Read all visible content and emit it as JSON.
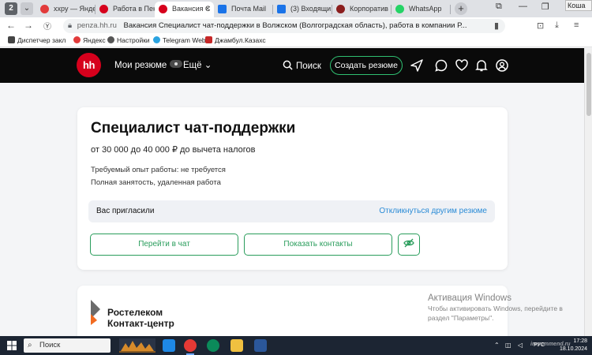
{
  "browser": {
    "tabs": [
      {
        "title": "хxpy — Яндекс",
        "color": "#e23b3b"
      },
      {
        "title": "Работа в Пен",
        "color": "#d6001c"
      },
      {
        "title": "Вакансия С",
        "color": "#d6001c",
        "active": true
      },
      {
        "title": "Почта Mail",
        "color": "#1a73e8"
      },
      {
        "title": "(3) Входящи",
        "color": "#1a73e8"
      },
      {
        "title": "Корпоратив",
        "color": "#8b1e1e"
      },
      {
        "title": "WhatsApp",
        "color": "#25d366"
      }
    ],
    "close_label": "×",
    "new_tab_label": "+",
    "corner_label": "Коша",
    "url_host": "penza.hh.ru",
    "url_title": "Вакансия Специалист чат-поддержки в Волжском (Волгоградская область), работа в компании Р...",
    "bookmarks": [
      {
        "label": "Диспетчер закл",
        "color": "#444"
      },
      {
        "label": "Яндекс",
        "color": "#e23b3b"
      },
      {
        "label": "Настройки",
        "color": "#555"
      },
      {
        "label": "Telegram Web",
        "color": "#2aa3e0"
      },
      {
        "label": "Джамбул.Казахс",
        "color": "#c62828"
      }
    ]
  },
  "header": {
    "logo": "hh",
    "my_resumes": "Мои резюме",
    "more": "Ещё",
    "search": "Поиск",
    "create_resume": "Создать резюме"
  },
  "vacancy": {
    "title": "Специалист чат-поддержки",
    "salary": "от 30 000 до 40 000 ₽ до вычета налогов",
    "experience": "Требуемый опыт работы: не требуется",
    "employment": "Полная занятость, удаленная работа",
    "invited": "Вас пригласили",
    "respond_other": "Откликнуться другим резюме",
    "go_chat": "Перейти в чат",
    "show_contacts": "Показать контакты"
  },
  "company": {
    "name": "Ростелеком",
    "sub": "Контакт-центр"
  },
  "activation": {
    "title": "Активация Windows",
    "line1": "Чтобы активировать Windows, перейдите в",
    "line2": "раздел \"Параметры\"."
  },
  "taskbar": {
    "search": "Поиск",
    "time": "17:28",
    "date": "18.10.2024",
    "lang": "РУС"
  },
  "watermark": "irecommend.ru"
}
